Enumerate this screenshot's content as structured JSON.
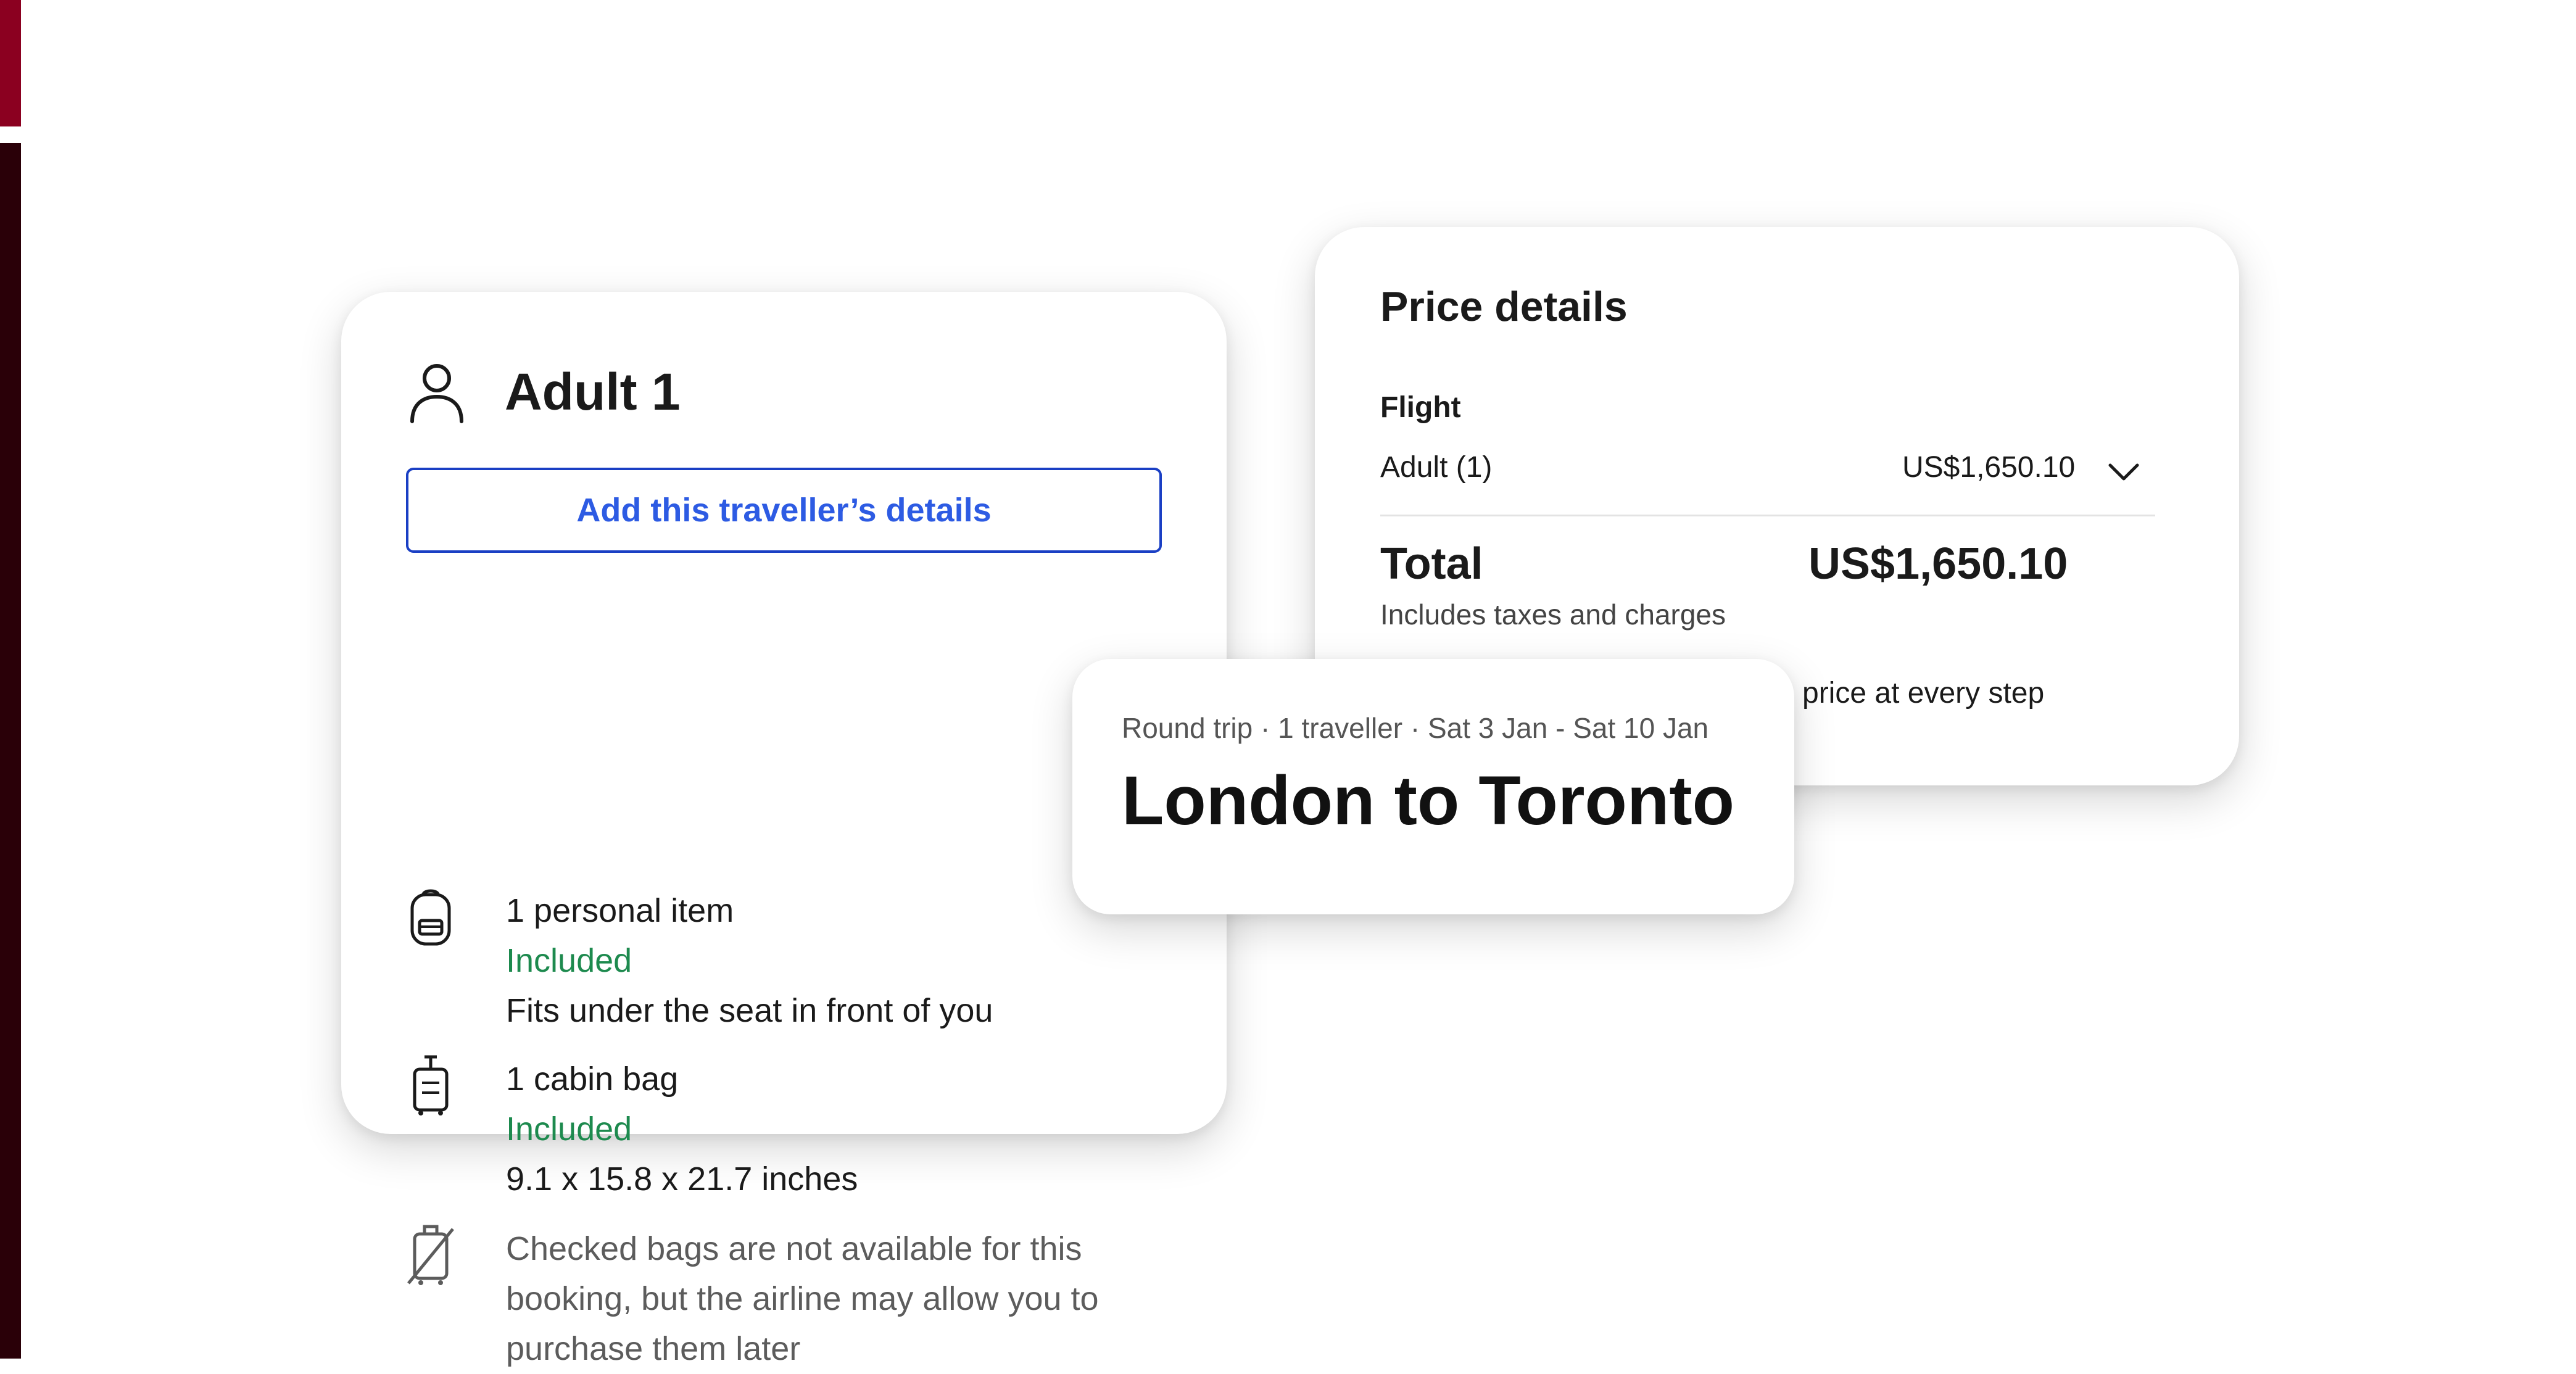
{
  "traveller": {
    "title": "Adult 1",
    "add_button_label": "Add this traveller’s details",
    "items": [
      {
        "icon": "backpack-icon",
        "name": "1 personal item",
        "status": "Included",
        "detail": "Fits under the seat in front of you"
      },
      {
        "icon": "cabin-bag-icon",
        "name": "1 cabin bag",
        "status": "Included",
        "detail": "9.1 x 15.8 x 21.7 inches"
      },
      {
        "icon": "no-checked-bag-icon",
        "line1": "Checked bags are not available for this",
        "line2": "booking, but the airline may allow you to",
        "line3": "purchase them later"
      }
    ]
  },
  "price": {
    "title": "Price details",
    "section_label": "Flight",
    "adult_label": "Adult (1)",
    "adult_value": "US$1,650.10",
    "total_label": "Total",
    "total_value": "US$1,650.10",
    "total_note": "Includes taxes and charges",
    "partial_text": "price at every step"
  },
  "trip": {
    "subtitle": "Round trip · 1 traveller · Sat 3 Jan - Sat 10 Jan",
    "title": "London to Toronto"
  },
  "colors": {
    "accent_blue": "#1a3fc4",
    "included_green": "#1d8a4e",
    "stripe_top": "#8b0020",
    "stripe_bottom": "#2a0008"
  }
}
